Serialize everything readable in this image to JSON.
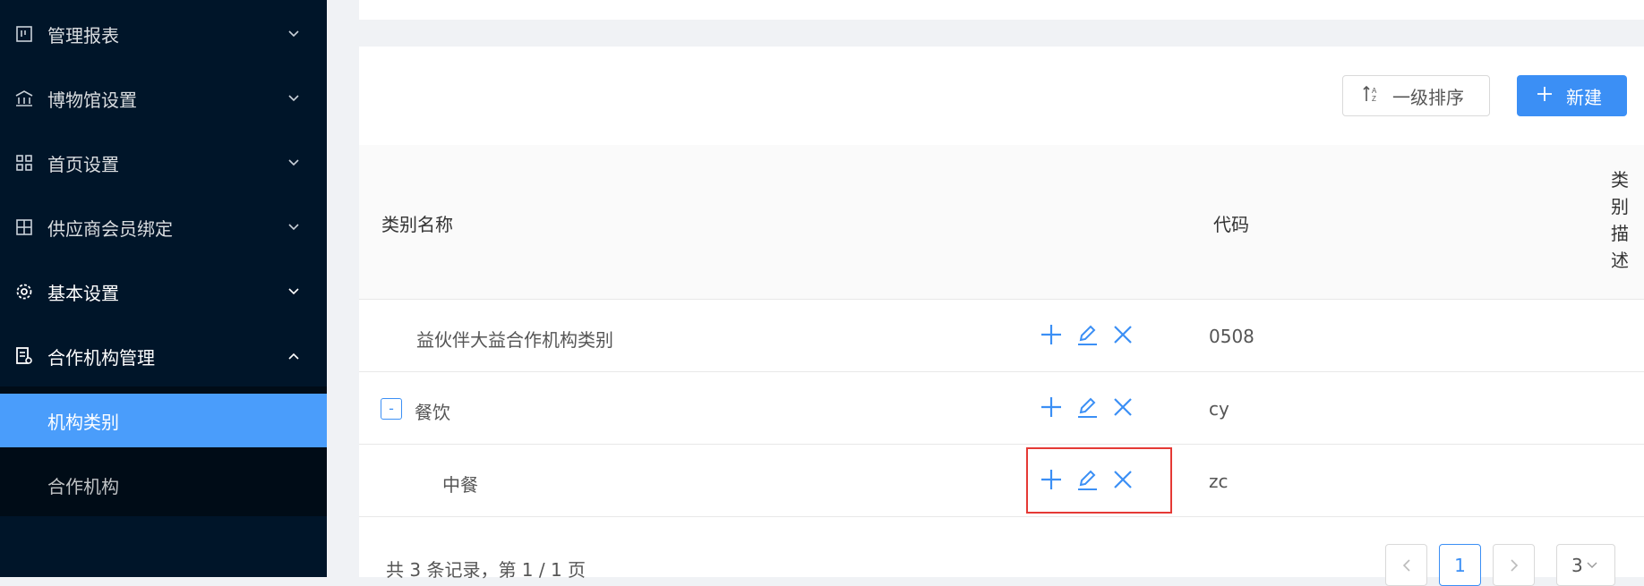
{
  "sidebar": {
    "items": [
      {
        "label": "管理报表",
        "icon": "report-icon"
      },
      {
        "label": "博物馆设置",
        "icon": "museum-icon"
      },
      {
        "label": "首页设置",
        "icon": "home-grid-icon"
      },
      {
        "label": "供应商会员绑定",
        "icon": "bind-icon"
      },
      {
        "label": "基本设置",
        "icon": "gear-icon"
      },
      {
        "label": "合作机构管理",
        "icon": "org-icon"
      }
    ],
    "subitems": [
      {
        "label": "机构类别",
        "active": true
      },
      {
        "label": "合作机构",
        "active": false
      }
    ]
  },
  "toolbar": {
    "sort_label": "一级排序",
    "new_label": "新建"
  },
  "table": {
    "headers": {
      "name": "类别名称",
      "code": "代码",
      "desc": "类别描述"
    },
    "rows": [
      {
        "name": "益伙伴大益合作机构类别",
        "code": "0508"
      },
      {
        "name": "餐饮",
        "code": "cy",
        "collapse": "-"
      },
      {
        "name": "中餐",
        "code": "zc"
      }
    ]
  },
  "pagination": {
    "summary": "共 3 条记录，第 1 / 1 页",
    "current": "1",
    "page_size": "3"
  },
  "colors": {
    "sidebar_bg": "#001529",
    "active": "#4a9dfb",
    "accent": "#3b8ff5",
    "highlight": "#e53935"
  }
}
